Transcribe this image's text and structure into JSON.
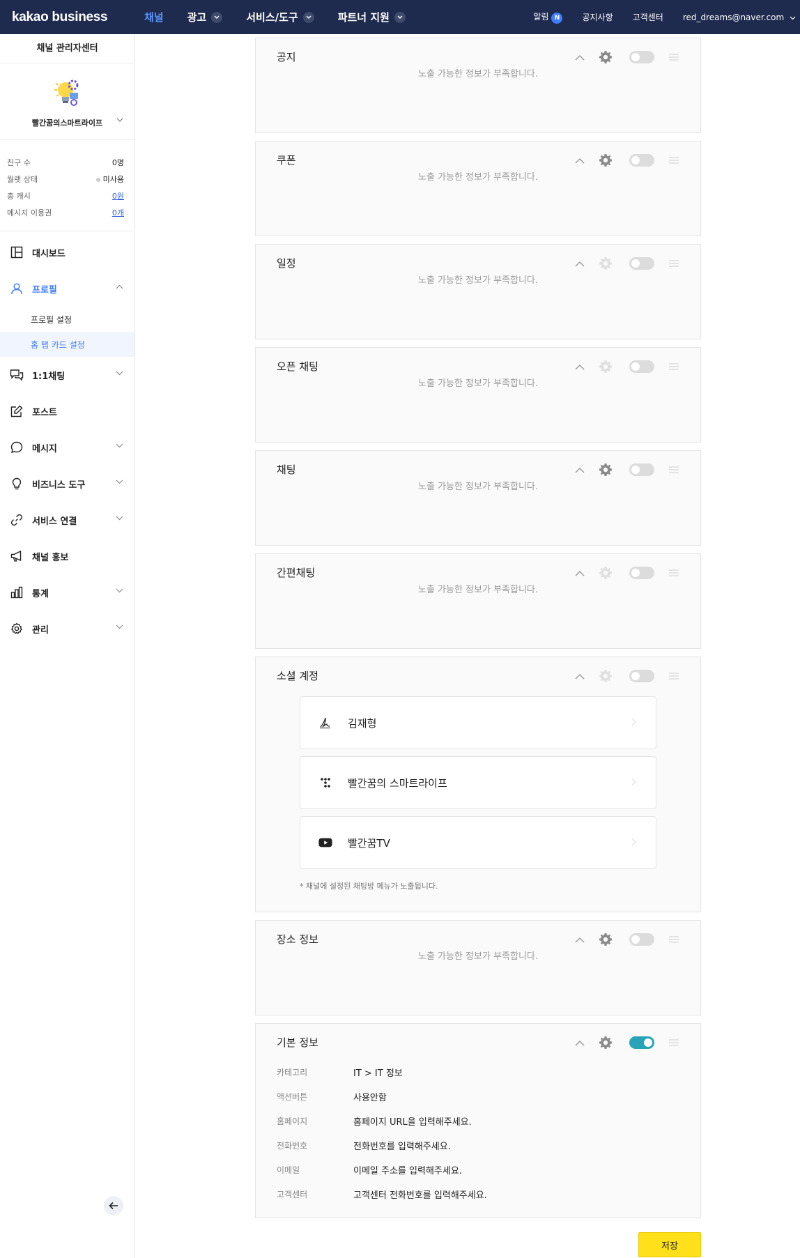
{
  "header": {
    "logo": "kakao business",
    "nav": [
      {
        "label": "채널",
        "active": true,
        "dropdown": false
      },
      {
        "label": "광고",
        "active": false,
        "dropdown": true
      },
      {
        "label": "서비스/도구",
        "active": false,
        "dropdown": true
      },
      {
        "label": "파트너 지원",
        "active": false,
        "dropdown": true
      }
    ],
    "alarm_label": "알림",
    "alarm_badge": "N",
    "notice_label": "공지사항",
    "support_label": "고객센터",
    "account": "red_dreams@naver.com"
  },
  "sidebar": {
    "title": "채널 관리자센터",
    "channel_name": "빨간꿈의스마트라이프",
    "stats": [
      {
        "label": "친구 수",
        "value": "0명",
        "link": false
      },
      {
        "label": "월렛 상태",
        "value": "미사용",
        "link": false,
        "dot": true
      },
      {
        "label": "총 캐시",
        "value": "0원",
        "link": true
      },
      {
        "label": "메시지 이용권",
        "value": "0개",
        "link": true
      }
    ],
    "menu": {
      "dashboard": "대시보드",
      "profile": "프로필",
      "profile_settings": "프로필 설정",
      "home_tab_card": "홈 탭 카드 설정",
      "chat": "1:1채팅",
      "post": "포스트",
      "message": "메시지",
      "business_tools": "비즈니스 도구",
      "service_link": "서비스 연결",
      "channel_promo": "채널 홍보",
      "stats": "통계",
      "manage": "관리"
    }
  },
  "cards": {
    "empty_text": "노출 가능한 정보가 부족합니다.",
    "notice": {
      "title": "공지"
    },
    "coupon": {
      "title": "쿠폰"
    },
    "schedule": {
      "title": "일정"
    },
    "open_chat": {
      "title": "오픈 채팅"
    },
    "chat": {
      "title": "채팅"
    },
    "simple_chat": {
      "title": "간편채팅"
    },
    "social": {
      "title": "소셜 계정",
      "items": [
        {
          "name": "김재형",
          "icon": "signature-icon"
        },
        {
          "name": "빨간꿈의 스마트라이프",
          "icon": "tistory-icon"
        },
        {
          "name": "빨간꿈TV",
          "icon": "youtube-icon"
        }
      ],
      "note": "* 채널에 설정된 채팅방 메뉴가 노출됩니다."
    },
    "place": {
      "title": "장소 정보"
    },
    "basic": {
      "title": "기본 정보",
      "rows": [
        {
          "label": "카테고리",
          "value": "IT > IT 정보"
        },
        {
          "label": "액션버튼",
          "value": "사용안함"
        },
        {
          "label": "홈페이지",
          "value": "홈페이지 URL을 입력해주세요."
        },
        {
          "label": "전화번호",
          "value": "전화번호를 입력해주세요."
        },
        {
          "label": "이메일",
          "value": "이메일 주소를 입력해주세요."
        },
        {
          "label": "고객센터",
          "value": "고객센터 전화번호를 입력해주세요."
        }
      ]
    }
  },
  "save_label": "저장",
  "colors": {
    "header_bg": "#1e2a4e",
    "accent": "#3d7dff",
    "toggle_on": "#27a4b8",
    "save": "#ffe01b"
  }
}
